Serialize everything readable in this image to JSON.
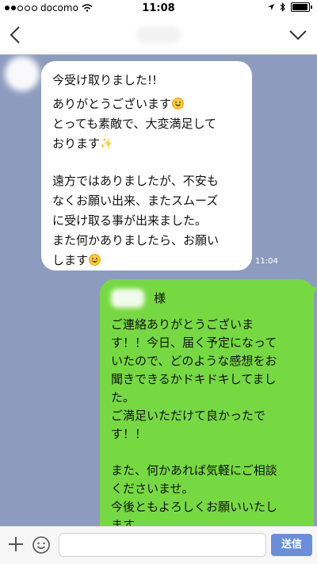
{
  "status_bar": {
    "carrier": "docomo",
    "time": "11:08",
    "signal_strength": 4,
    "battery": "full"
  },
  "nav": {
    "back_icon": "chevron-left-icon",
    "menu_icon": "chevron-down-icon"
  },
  "messages": {
    "incoming": {
      "lines": [
        "今受け取りました!!",
        "ありがとうございます",
        "とっても素敵で、大変満足して",
        "おります",
        "",
        "遠方ではありましたが、不安も",
        "なくお願い出来、またスムーズ",
        "に受け取る事が出来ました。",
        "また何かありましたら、お願い",
        "します"
      ],
      "time": "11:04"
    },
    "outgoing": {
      "honorific": "様",
      "lines": [
        "ご連絡ありがとうございま",
        "す！！今日、届く予定になって",
        "いたので、どのような感想をお",
        "聞きできるかドキドキしてまし",
        "た。",
        "ご満足いただけて良かったで",
        "す！！",
        "",
        "また、何かあれば気軽にご相談",
        "くださいませ。",
        "今後ともよろしくお願いいたし",
        "ます。"
      ]
    }
  },
  "input_bar": {
    "plus_icon": "plus-icon",
    "emoji_icon": "emoji-icon",
    "placeholder": "",
    "send_label": "送信"
  },
  "colors": {
    "chat_background": "#8d9bbf",
    "outgoing_bubble": "#77d942",
    "incoming_bubble": "#ffffff",
    "send_button": "#6a8edb"
  }
}
